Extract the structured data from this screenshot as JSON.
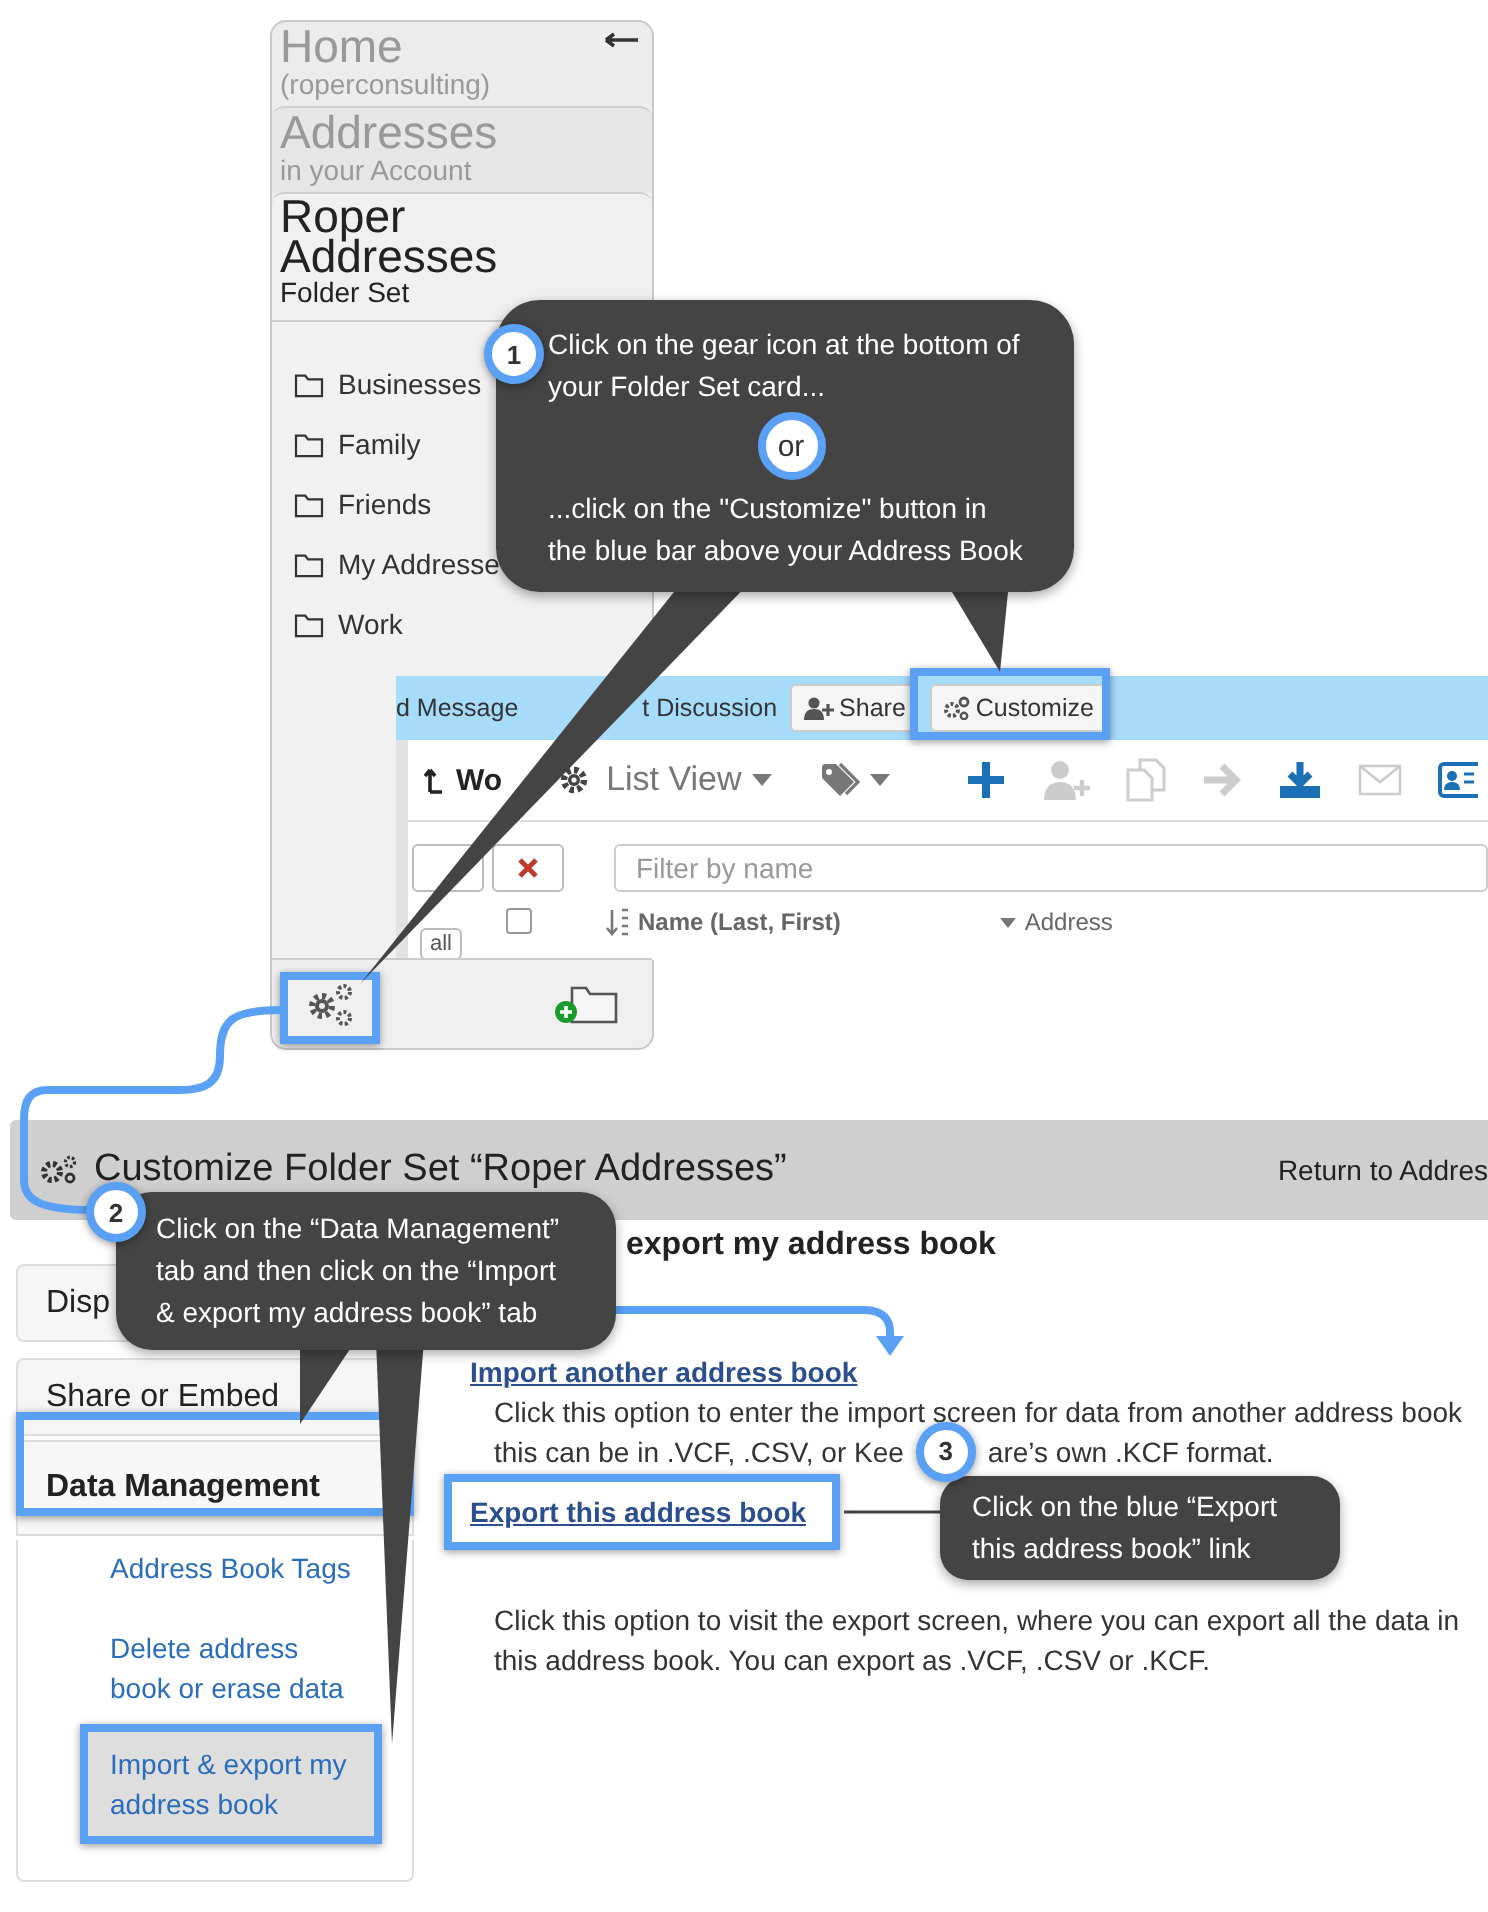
{
  "folder_set_card": {
    "levels": [
      {
        "title": "Home",
        "subtitle": "(roperconsulting)",
        "kind": "home"
      },
      {
        "title": "Addresses",
        "subtitle": "in your Account",
        "kind": "account"
      },
      {
        "title": "Roper Addresses",
        "subtitle": "Folder Set",
        "kind": "current"
      }
    ],
    "folders": [
      {
        "name": "Businesses"
      },
      {
        "name": "Family"
      },
      {
        "name": "Friends"
      },
      {
        "name": "My Addresse"
      },
      {
        "name": "Work"
      }
    ]
  },
  "address_book": {
    "blue_bar": {
      "links": [
        "d Message",
        "t Discussion"
      ],
      "buttons": [
        {
          "label": "Share",
          "kind": "share"
        },
        {
          "label": "Customize",
          "kind": "customize"
        }
      ]
    },
    "folder_name": "Wo",
    "view": "List View",
    "filter": {
      "placeholder": "Filter by name"
    },
    "select_all": "all",
    "header_checkbox": {
      "checked": false
    },
    "columns": [
      {
        "label": "Name (Last, First)",
        "kind": "sort"
      },
      {
        "label": "Address",
        "kind": "menu"
      }
    ]
  },
  "customize_page": {
    "title": "Customize Folder Set “Roper Addresses”",
    "return_link": "Return to Addres",
    "tabs": [
      {
        "label": "Disp",
        "selected": false
      },
      {
        "label": "Share or Embed",
        "selected": false
      },
      {
        "label": "Data Management",
        "selected": true
      }
    ],
    "sub_items": [
      {
        "label": "Address Book Tags",
        "selected": false
      },
      {
        "label": "Delete address\nbook or erase data",
        "selected": false
      },
      {
        "label": "Import & export my\naddress book",
        "selected": true
      }
    ],
    "heading": "export my address book",
    "import_option": {
      "link": "Import another address book",
      "lines": [
        "Click this option to enter the import screen for data from another address book",
        "this can be in .VCF, .CSV, or Kee",
        "are’s own .KCF format."
      ]
    },
    "export_option": {
      "link": "Export this address book",
      "description": "Click this option to visit the export screen, where you can export all the data in this address book. You can export as .VCF, .CSV or .KCF."
    }
  },
  "callouts": [
    {
      "number": "1",
      "text": "Click on the gear icon at the bottom of\nyour Folder Set card...",
      "separator": "or",
      "text_after": "...click on the \"Customize\" button in\nthe blue bar above your Address Book"
    },
    {
      "number": "2",
      "text": "Click on the “Data Management”\ntab and then click on the “Import\n& export my address book” tab"
    },
    {
      "number": "3",
      "text": "Click on the blue “Export\nthis address book” link"
    }
  ]
}
